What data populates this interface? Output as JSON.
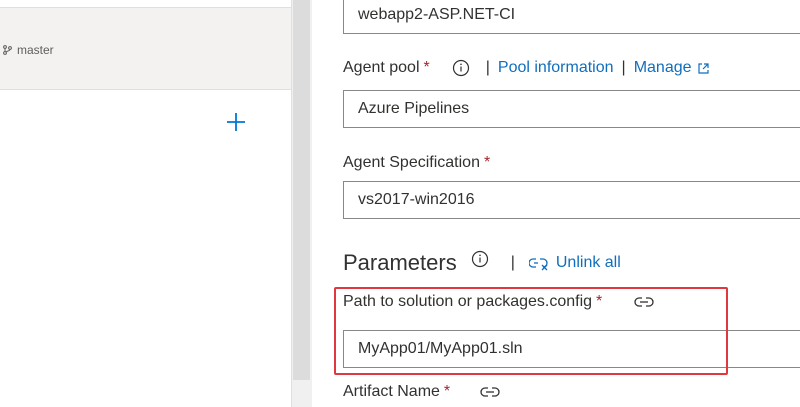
{
  "left": {
    "branch_name": "master"
  },
  "pipeline_name_value": "webapp2-ASP.NET-CI",
  "agent_pool": {
    "label": "Agent pool",
    "required": "*",
    "pool_information_link": "Pool information",
    "manage_link": "Manage",
    "value": "Azure Pipelines"
  },
  "agent_spec": {
    "label": "Agent Specification",
    "required": "*",
    "value": "vs2017-win2016"
  },
  "parameters": {
    "title": "Parameters",
    "unlink_all": "Unlink all"
  },
  "solution_path": {
    "label": "Path to solution or packages.config",
    "required": "*",
    "value": "MyApp01/MyApp01.sln"
  },
  "artifact_name": {
    "label": "Artifact Name",
    "required": "*"
  },
  "colors": {
    "link": "#106ebe",
    "required": "#a4262c",
    "highlight": "#e0383e"
  }
}
